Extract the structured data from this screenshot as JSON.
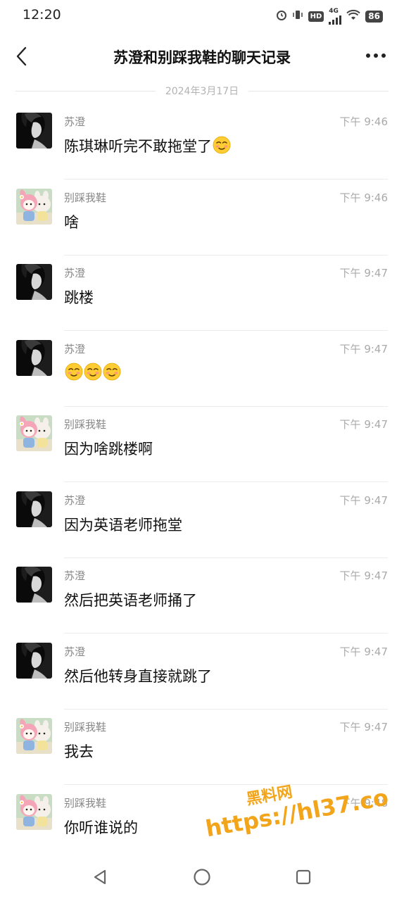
{
  "status_bar": {
    "time": "12:20",
    "network": "4G",
    "hd": "HD",
    "battery": "86"
  },
  "header": {
    "title": "苏澄和别踩我鞋的聊天记录"
  },
  "date_separator": "2024年3月17日",
  "messages": [
    {
      "sender": "苏澄",
      "time": "下午 9:46",
      "text": "陈琪琳听完不敢拖堂了",
      "emoji_count": 1,
      "avatar": "dark-portrait"
    },
    {
      "sender": "别踩我鞋",
      "time": "下午 9:46",
      "text": "啥",
      "emoji_count": 0,
      "avatar": "pink-cartoon"
    },
    {
      "sender": "苏澄",
      "time": "下午 9:47",
      "text": "跳楼",
      "emoji_count": 0,
      "avatar": "dark-portrait"
    },
    {
      "sender": "苏澄",
      "time": "下午 9:47",
      "text": "",
      "emoji_count": 3,
      "avatar": "dark-portrait"
    },
    {
      "sender": "别踩我鞋",
      "time": "下午 9:47",
      "text": "因为啥跳楼啊",
      "emoji_count": 0,
      "avatar": "pink-cartoon"
    },
    {
      "sender": "苏澄",
      "time": "下午 9:47",
      "text": "因为英语老师拖堂",
      "emoji_count": 0,
      "avatar": "dark-portrait"
    },
    {
      "sender": "苏澄",
      "time": "下午 9:47",
      "text": "然后把英语老师捅了",
      "emoji_count": 0,
      "avatar": "dark-portrait"
    },
    {
      "sender": "苏澄",
      "time": "下午 9:47",
      "text": "然后他转身直接就跳了",
      "emoji_count": 0,
      "avatar": "dark-portrait"
    },
    {
      "sender": "别踩我鞋",
      "time": "下午 9:47",
      "text": "我去",
      "emoji_count": 0,
      "avatar": "pink-cartoon"
    },
    {
      "sender": "别踩我鞋",
      "time": "下午 9:48",
      "text": "你听谁说的",
      "emoji_count": 0,
      "avatar": "pink-cartoon"
    }
  ],
  "watermark": {
    "title": "黑料网",
    "url": "https://hl37.co"
  },
  "colors": {
    "background": "#ffffff",
    "watermark": "#f2a51a",
    "secondary_text": "#888888"
  }
}
